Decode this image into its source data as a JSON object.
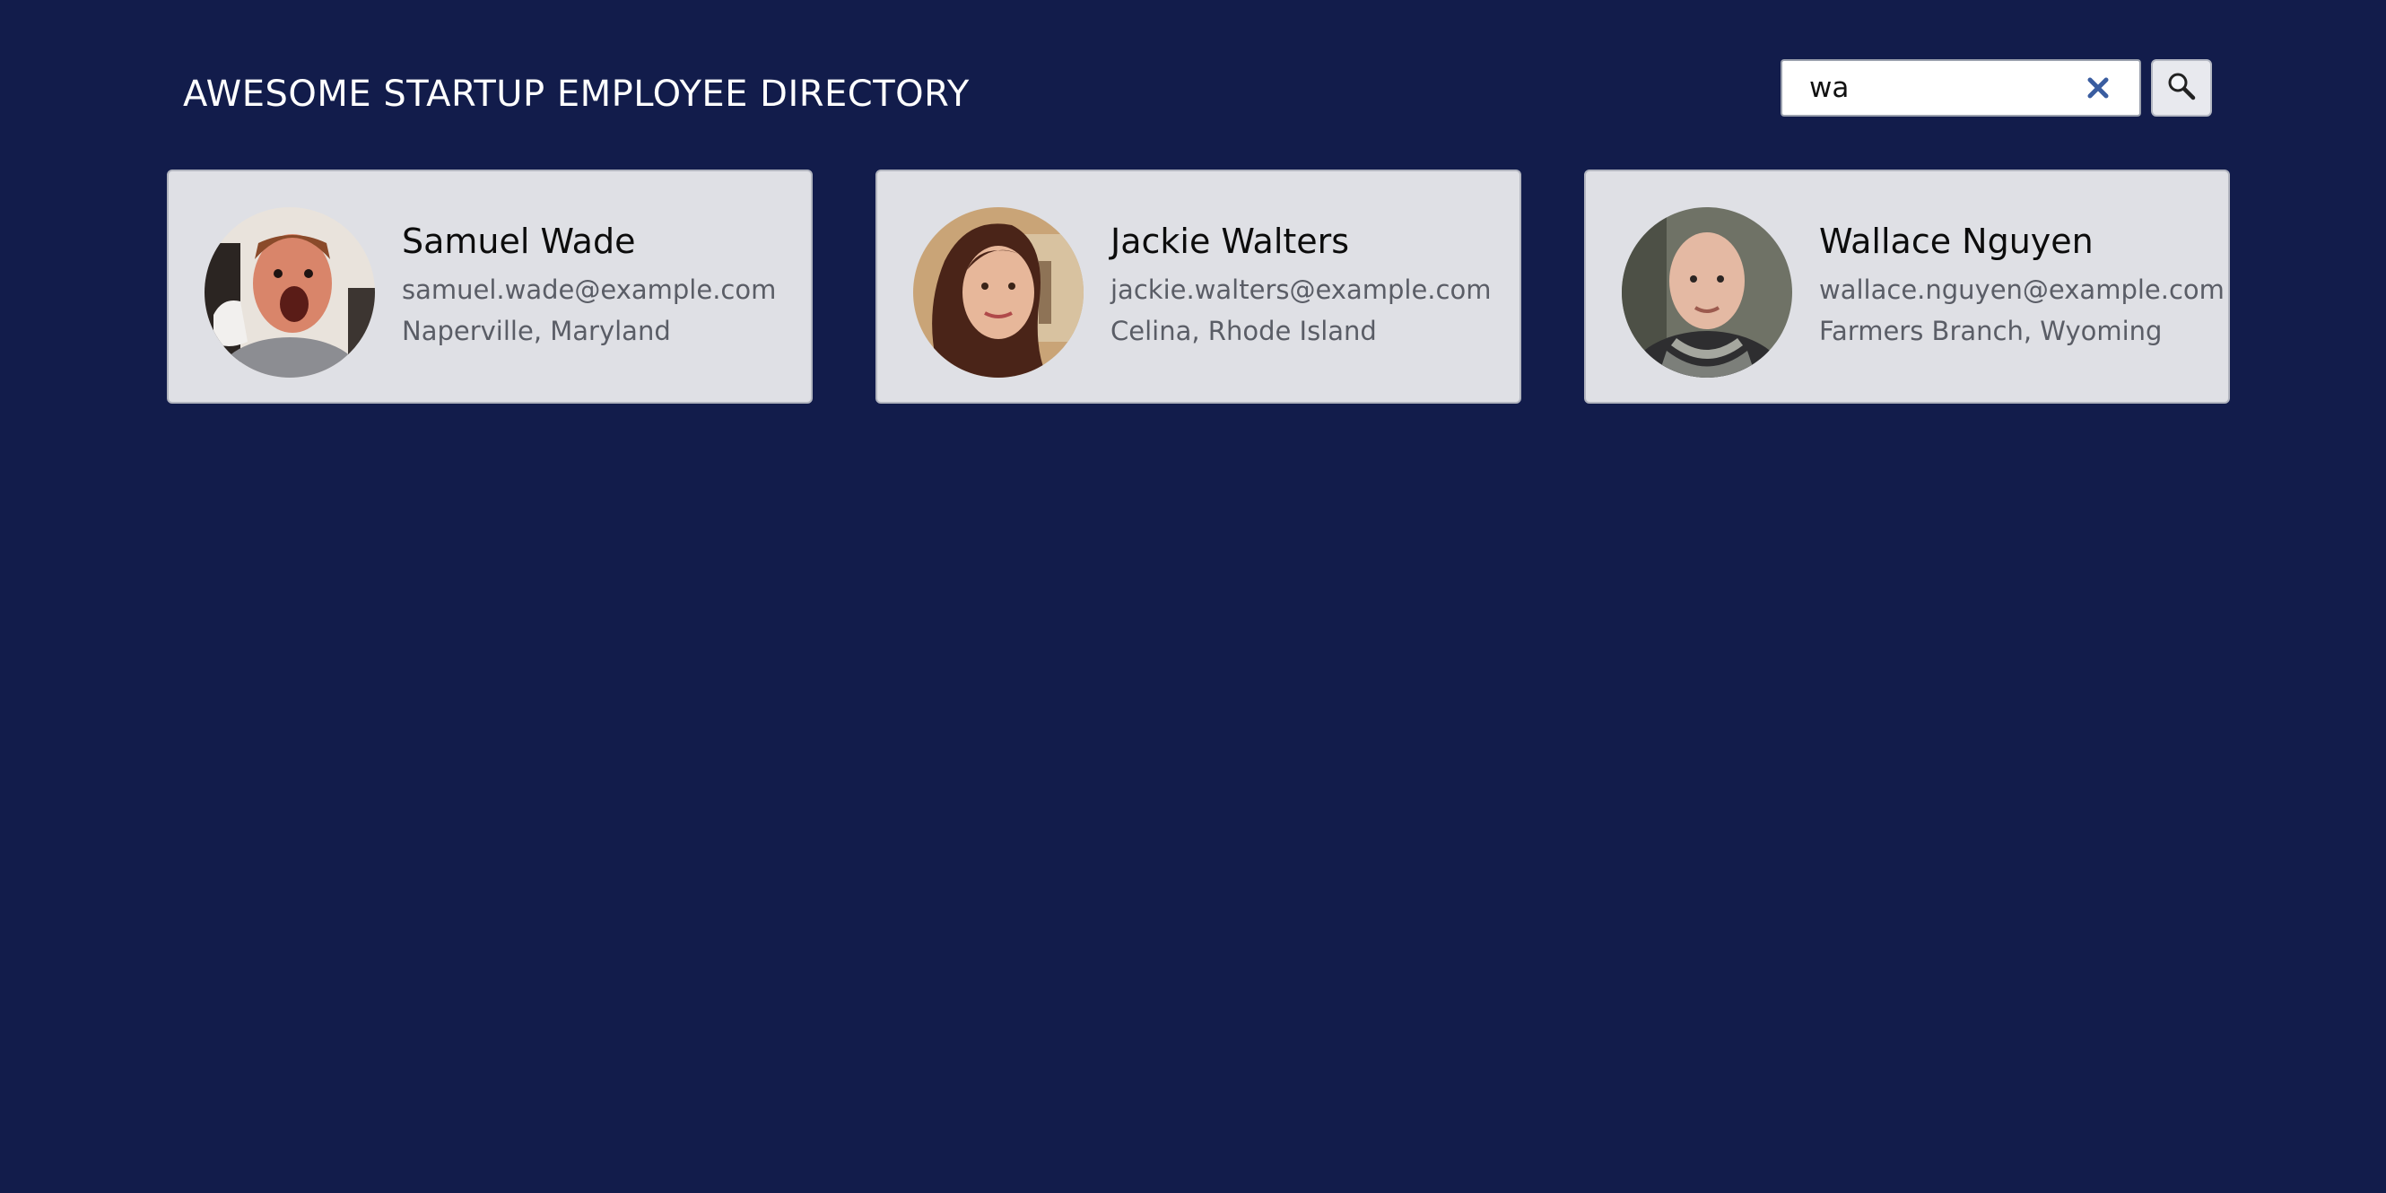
{
  "header": {
    "title": "AWESOME STARTUP EMPLOYEE DIRECTORY"
  },
  "search": {
    "value": "wa",
    "clear_icon": "close-icon",
    "button_icon": "search-icon"
  },
  "colors": {
    "background": "#121c4b",
    "card": "#dfe0e5",
    "clear_icon": "#3a5da0"
  },
  "employees": [
    {
      "name": "Samuel Wade",
      "email": "samuel.wade@example.com",
      "location": "Naperville, Maryland"
    },
    {
      "name": "Jackie Walters",
      "email": "jackie.walters@example.com",
      "location": "Celina, Rhode Island"
    },
    {
      "name": "Wallace Nguyen",
      "email": "wallace.nguyen@example.com",
      "location": "Farmers Branch, Wyoming"
    }
  ]
}
